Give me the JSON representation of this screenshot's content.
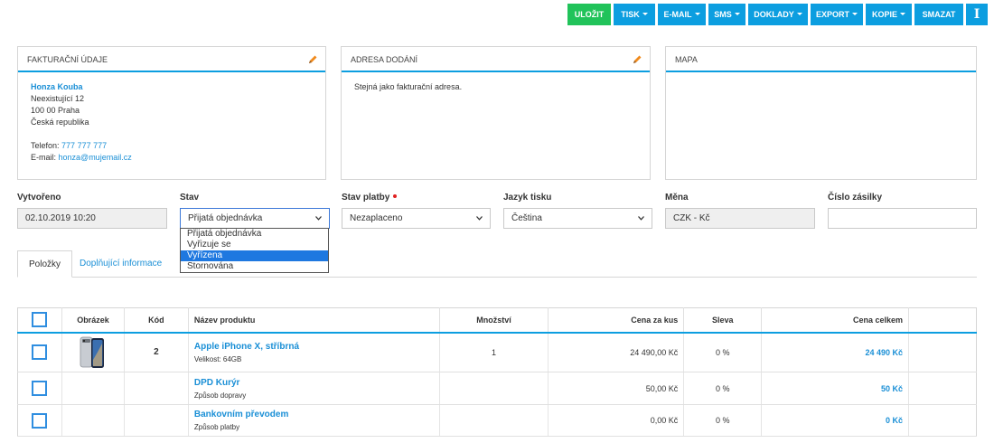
{
  "toolbar": {
    "save": "ULOŽIT",
    "print": "TISK",
    "email": "E-MAIL",
    "sms": "SMS",
    "documents": "DOKLADY",
    "export": "EXPORT",
    "copies": "KOPIE",
    "delete": "SMAZAT",
    "info": "i"
  },
  "billing": {
    "title": "FAKTURAČNÍ ÚDAJE",
    "name": "Honza Kouba",
    "street": "Neexistující 12",
    "city": "100 00 Praha",
    "country": "Česká republika",
    "phone_label": "Telefon:",
    "phone": "777 777 777",
    "email_label": "E-mail:",
    "email": "honza@mujemail.cz"
  },
  "delivery": {
    "title": "ADRESA DODÁNÍ",
    "text": "Stejná jako fakturační adresa."
  },
  "map": {
    "title": "MAPA"
  },
  "fields": {
    "created_label": "Vytvořeno",
    "created_value": "02.10.2019 10:20",
    "status_label": "Stav",
    "status_value": "Přijatá objednávka",
    "status_options": [
      "Přijatá objednávka",
      "Vyřizuje se",
      "Vyřízena",
      "Stornována"
    ],
    "payment_label": "Stav platby",
    "payment_value": "Nezaplaceno",
    "language_label": "Jazyk tisku",
    "language_value": "Čeština",
    "currency_label": "Měna",
    "currency_value": "CZK - Kč",
    "parcel_label": "Číslo zásilky",
    "parcel_value": ""
  },
  "tabs": {
    "items": "Položky",
    "extra": "Doplňující informace"
  },
  "table": {
    "headers": {
      "image": "Obrázek",
      "code": "Kód",
      "name": "Název produktu",
      "qty": "Množství",
      "unit_price": "Cena za kus",
      "discount": "Sleva",
      "total": "Cena celkem"
    },
    "rows": [
      {
        "code": "2",
        "name": "Apple iPhone X, stříbrná",
        "sub": "Velikost: 64GB",
        "qty": "1",
        "unit_price": "24 490,00 Kč",
        "discount": "0 %",
        "total": "24 490 Kč"
      },
      {
        "code": "",
        "name": "DPD Kurýr",
        "sub": "Způsob dopravy",
        "qty": "",
        "unit_price": "50,00 Kč",
        "discount": "0 %",
        "total": "50 Kč"
      },
      {
        "code": "",
        "name": "Bankovním převodem",
        "sub": "Způsob platby",
        "qty": "",
        "unit_price": "0,00 Kč",
        "discount": "0 %",
        "total": "0 Kč"
      }
    ]
  },
  "colors": {
    "primary": "#0c9ee0",
    "save": "#21c35a",
    "link": "#1a8fd6",
    "required": "#e02020"
  }
}
